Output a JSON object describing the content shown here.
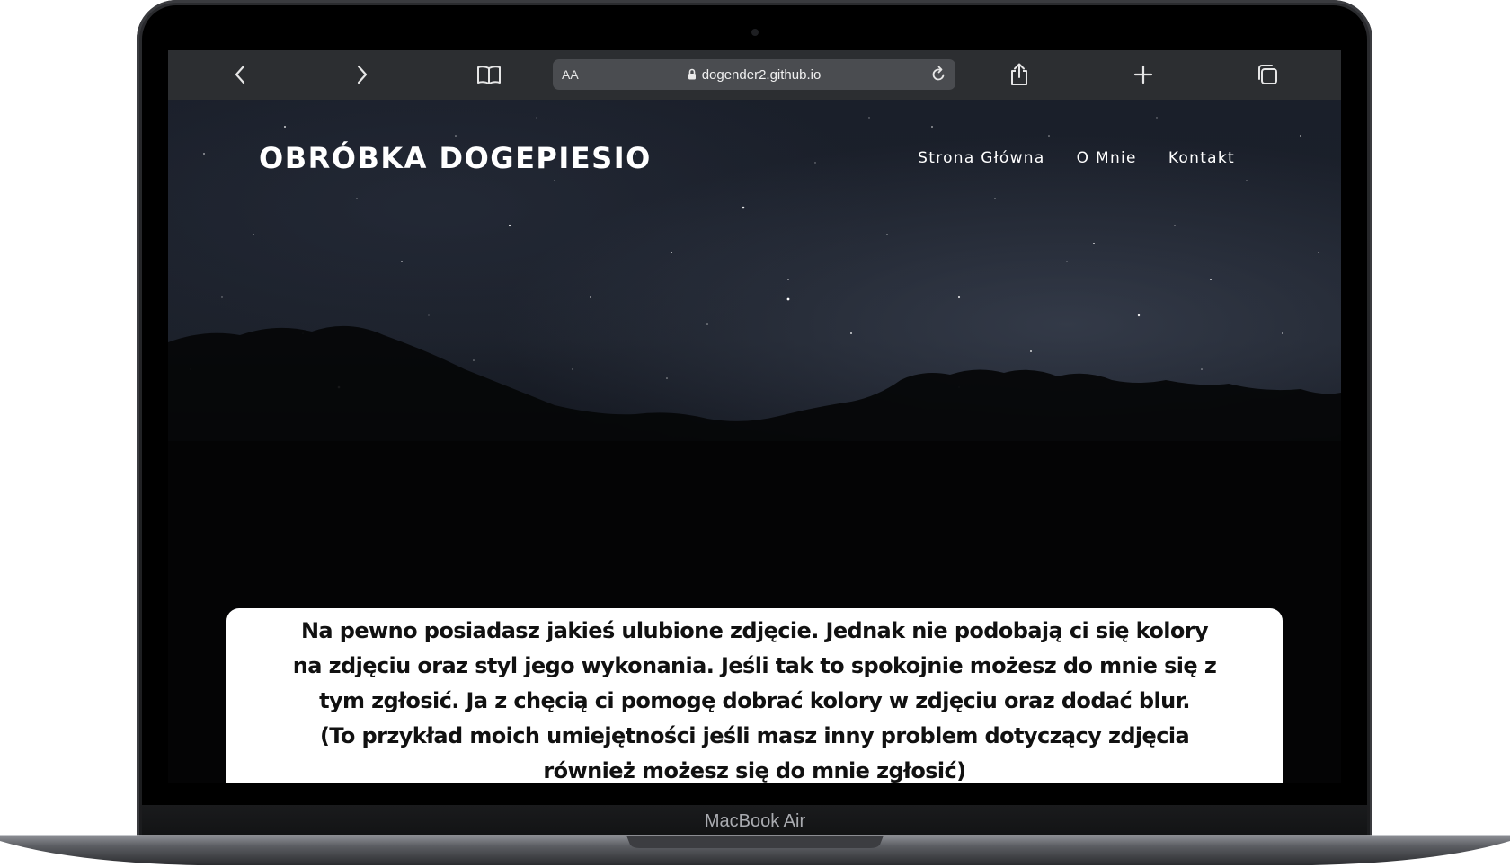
{
  "browser": {
    "reader_label": "AA",
    "url": "dogender2.github.io",
    "icons": [
      "back-icon",
      "forward-icon",
      "bookmarks-icon",
      "lock-icon",
      "reload-icon",
      "share-icon",
      "new-tab-icon",
      "tabs-icon"
    ]
  },
  "site": {
    "brand": "OBRÓBKA DOGEPIESIO",
    "nav": [
      "Strona Główna",
      "O Mnie",
      "Kontakt"
    ]
  },
  "hero": {
    "lines": [
      "Na pewno posiadasz jakieś ulubione zdjęcie. Jednak nie podobają ci się kolory",
      "na zdjęciu oraz styl jego wykonania. Jeśli tak to spokojnie możesz do mnie się z",
      "tym zgłosić. Ja z chęcią ci pomogę dobrać kolory w zdjęciu oraz dodać blur.",
      "(To przykład moich umiejętności jeśli masz inny problem dotyczący zdjęcia",
      "również możesz się do mnie zgłosić)"
    ]
  },
  "device": {
    "label": "MacBook Air"
  }
}
